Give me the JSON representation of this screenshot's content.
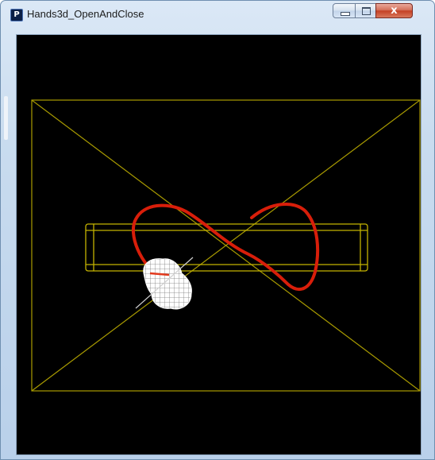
{
  "window": {
    "title": "Hands3d_OpenAndClose",
    "app_icon_letter": "P"
  },
  "caption_buttons": {
    "minimize": "minimize",
    "maximize": "maximize",
    "close_glyph": "x"
  },
  "scene": {
    "background": "#000000",
    "wire_color": "#a99b00",
    "trail_color": "#d81e0a",
    "hand_color": "#ffffff"
  }
}
